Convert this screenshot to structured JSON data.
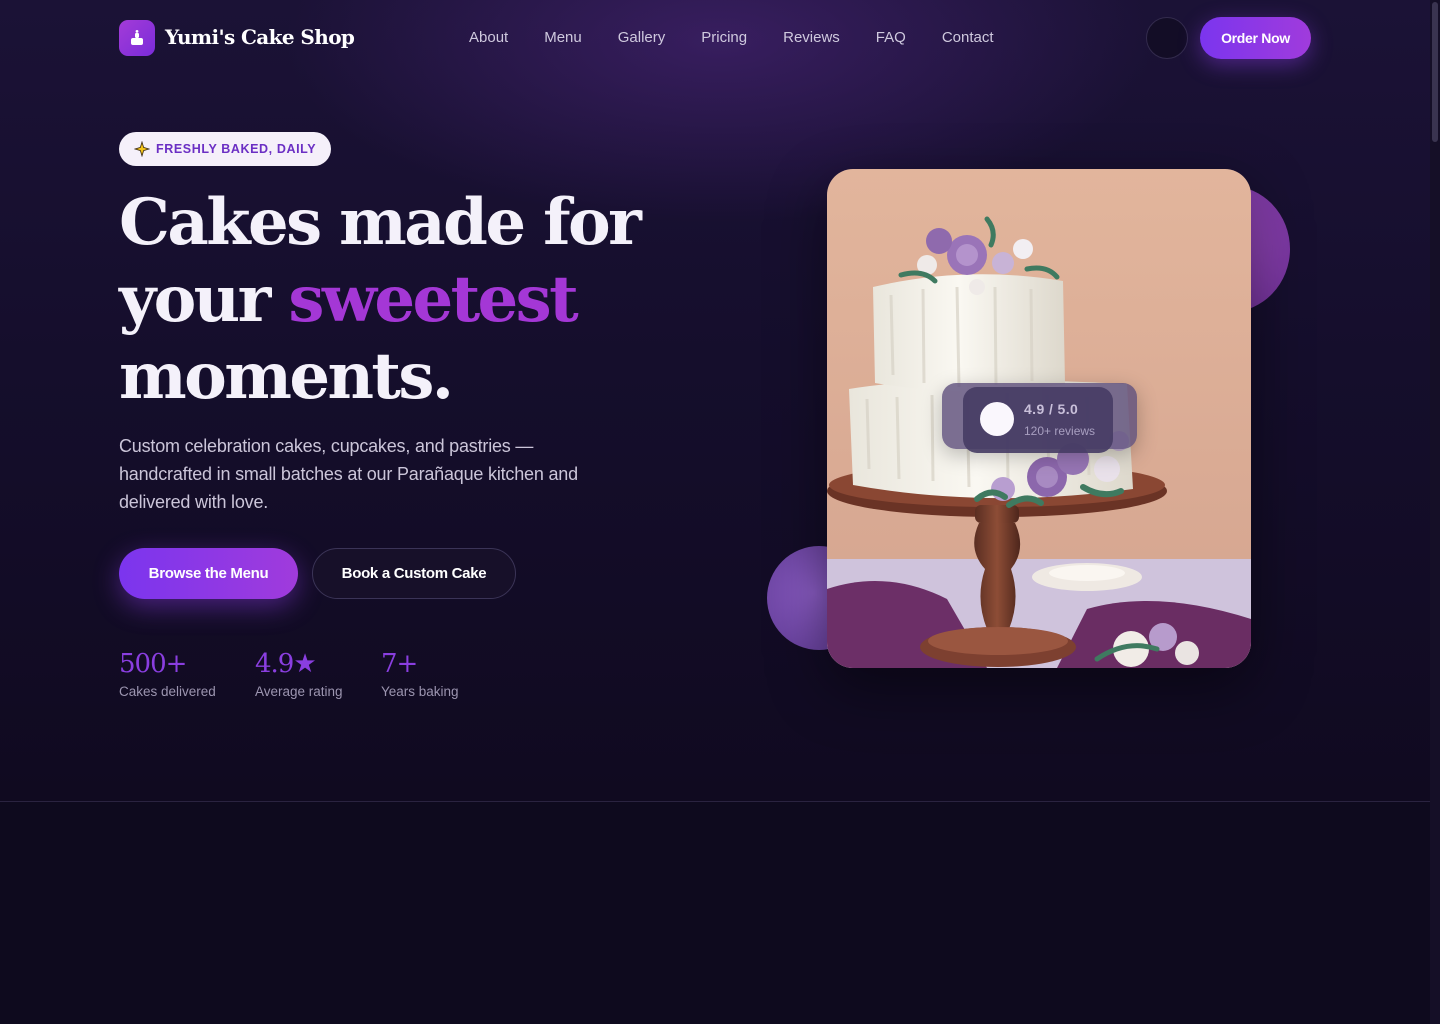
{
  "brand": {
    "name": "Yumi's Cake Shop",
    "logo_icon": "cake-icon",
    "accent": "#a33bd8"
  },
  "nav": {
    "links": [
      "About",
      "Menu",
      "Gallery",
      "Pricing",
      "Reviews",
      "FAQ",
      "Contact"
    ],
    "order_label": "Order Now",
    "theme_toggle_icon": "theme-toggle-icon"
  },
  "hero": {
    "badge": "FRESHLY BAKED, DAILY",
    "badge_icon": "sparkle-icon",
    "headline_part1": "Cakes made for your",
    "headline_accent": "sweetest",
    "headline_part2": "moments.",
    "subtitle": "Custom celebration cakes, cupcakes, and pastries — handcrafted in small batches at our Parañaque kitchen and delivered with love.",
    "primary_cta": "Browse the Menu",
    "secondary_cta": "Book a Custom Cake",
    "stats": [
      {
        "value": "500+",
        "label": "Cakes delivered"
      },
      {
        "value": "4.9★",
        "label": "Average rating"
      },
      {
        "value": "7+",
        "label": "Years baking"
      }
    ]
  },
  "rating_card": {
    "score": "4.9 / 5.0",
    "count": "120+ reviews"
  },
  "colors": {
    "background": "#0f0a1f",
    "primary": "#7b35ee",
    "accent_text": "#a437d6",
    "stat": "#8a3ee0"
  }
}
